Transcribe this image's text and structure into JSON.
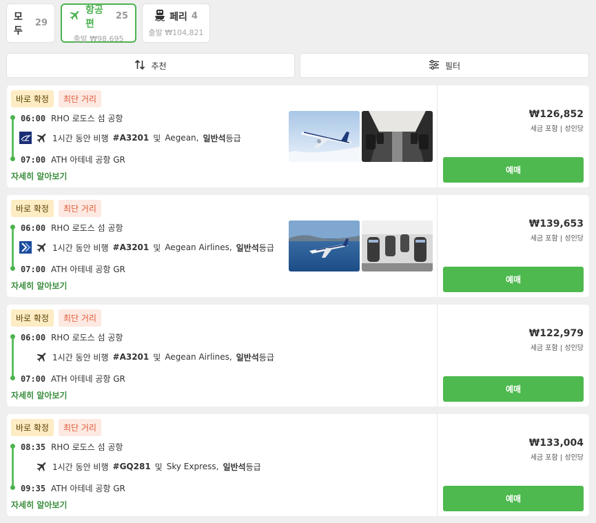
{
  "tabs": {
    "all": {
      "label": "모두",
      "count": "29"
    },
    "flight": {
      "label": "항공편",
      "count": "25",
      "sub": "출발 ₩98,695"
    },
    "ferry": {
      "label": "페리",
      "count": "4",
      "sub": "출발 ₩104,821"
    }
  },
  "toolbar": {
    "sort_label": "추천",
    "filter_label": "필터"
  },
  "colors": {
    "accent": "#4db250",
    "book_button": "#4db94e",
    "badge_confirm_bg": "#fdecc4",
    "badge_shortest_bg": "#fde9e1"
  },
  "card_common": {
    "badge_confirm": "바로 확정",
    "badge_shortest": "최단 거리",
    "details_link": "자세히 알아보기",
    "book_label": "예매",
    "price_note": "세금 포함 | 성인당",
    "flight_prefix": "1시간 동안 비행",
    "and_word": "및",
    "cabin": "일반석",
    "cabin_suffix": "등급"
  },
  "results": [
    {
      "dep_time": "06:00",
      "dep_place": "RHO 로도스 섬 공항",
      "arr_time": "07:00",
      "arr_place": "ATH 아테네 공항 GR",
      "flight_no": "#A3201",
      "carrier": "Aegean,",
      "logo": "aegean-logo-icon",
      "price": "₩126,852"
    },
    {
      "dep_time": "06:00",
      "dep_place": "RHO 로도스 섬 공항",
      "arr_time": "07:00",
      "arr_place": "ATH 아테네 공항 GR",
      "flight_no": "#A3201",
      "carrier": "Aegean Airlines,",
      "logo": "aegean-airlines-logo-icon",
      "price": "₩139,653"
    },
    {
      "dep_time": "06:00",
      "dep_place": "RHO 로도스 섬 공항",
      "arr_time": "07:00",
      "arr_place": "ATH 아테네 공항 GR",
      "flight_no": "#A3201",
      "carrier": "Aegean Airlines,",
      "logo": "",
      "price": "₩122,979"
    },
    {
      "dep_time": "08:35",
      "dep_place": "RHO 로도스 섬 공항",
      "arr_time": "09:35",
      "arr_place": "ATH 아테네 공항 GR",
      "flight_no": "#GQ281",
      "carrier": "Sky Express,",
      "logo": "",
      "price": "₩133,004"
    }
  ]
}
